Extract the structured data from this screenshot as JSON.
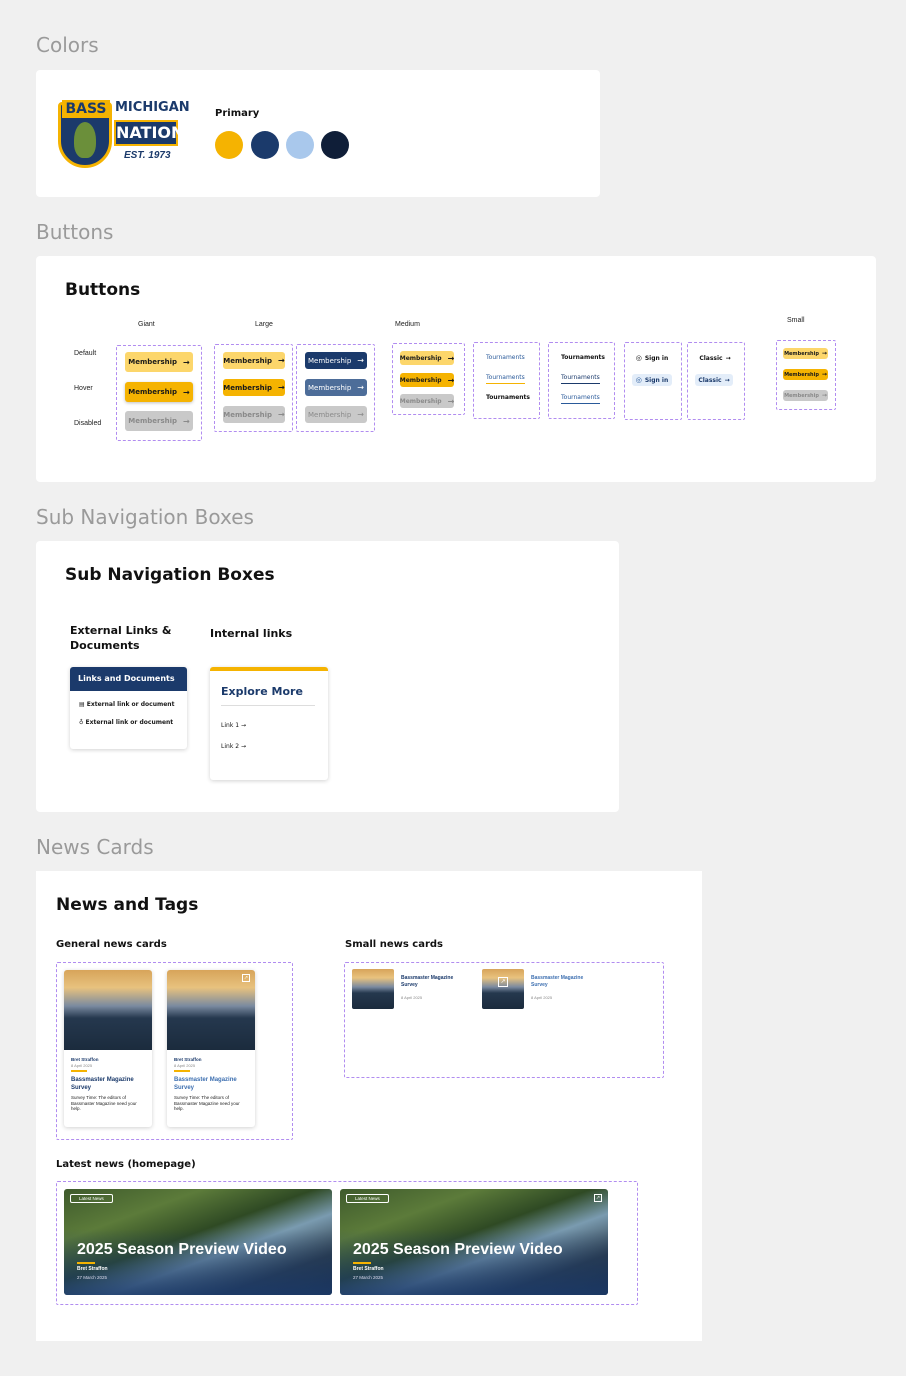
{
  "sections": {
    "colors": "Colors",
    "buttons": "Buttons",
    "subnav": "Sub Navigation Boxes",
    "news": "News Cards"
  },
  "logo": {
    "line1": "BASS",
    "line2": "MICHIGAN",
    "line3": "NATION",
    "line4": "EST. 1973"
  },
  "colors": {
    "label": "Primary",
    "swatches": [
      "#f5b301",
      "#1b3a6b",
      "#a9c8ec",
      "#0f1e38"
    ]
  },
  "buttons": {
    "title": "Buttons",
    "sizes": {
      "giant": "Giant",
      "large": "Large",
      "medium": "Medium",
      "small": "Small"
    },
    "states": {
      "default": "Default",
      "hover": "Hover",
      "disabled": "Disabled"
    },
    "membership": "Membership",
    "tournaments": "Tournaments",
    "signin": "Sign in",
    "classic": "Classic"
  },
  "subnav": {
    "title": "Sub Navigation Boxes",
    "external_heading": "External Links & Documents",
    "internal_heading": "Internal links",
    "links_header": "Links and Documents",
    "ext_link_1": "External link or document",
    "ext_link_2": "External link or document",
    "explore_title": "Explore More",
    "link_1": "Link 1",
    "link_2": "Link 2"
  },
  "news": {
    "title": "News and Tags",
    "general_heading": "General news cards",
    "small_heading": "Small news cards",
    "latest_heading": "Latest news (homepage)",
    "author": "Bret Straffon",
    "date": "8 April 2025",
    "headline": "Bassmaster Magazine Survey",
    "excerpt": "Survey Time: The editors of Bassmaster Magazine need your help.",
    "small_date": "8 April 2025",
    "latest_tag": "Latest News",
    "latest_title": "2025 Season Preview Video",
    "latest_author": "Bret Straffon",
    "latest_date": "27 March 2025"
  }
}
